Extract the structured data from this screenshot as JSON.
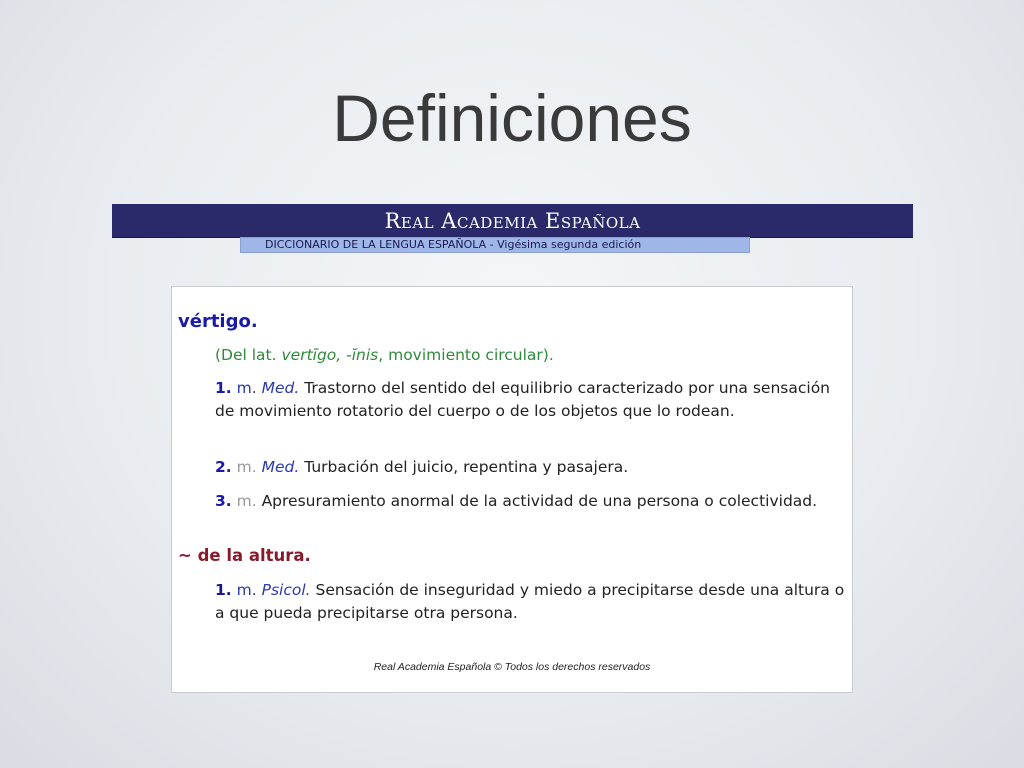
{
  "slide": {
    "title": "Definiciones"
  },
  "rae": {
    "name": "Real Academia Española",
    "subtitle": "DICCIONARIO DE LA LENGUA ESPAÑOLA - Vigésima segunda edición"
  },
  "entry": {
    "headword": "vértigo",
    "headword_dot": ".",
    "etymology": {
      "prefix": "(Del lat. ",
      "latin": "vertīgo, -ĭnis",
      "suffix": ", movimiento circular)."
    },
    "senses": [
      {
        "number": "1.",
        "grammar": "m.",
        "field": "Med.",
        "definition": " Trastorno del sentido del equilibrio caracterizado por una sensación de movimiento rotatorio del cuerpo o de los objetos que lo rodean."
      },
      {
        "number": "2.",
        "grammar": "m.",
        "field": "Med.",
        "definition": " Turbación del juicio, repentina y pasajera."
      },
      {
        "number": "3.",
        "grammar": "m.",
        "field": "",
        "definition": " Apresuramiento anormal de la actividad de una persona o colectividad."
      }
    ],
    "subentry": {
      "phrase": "~ de la altura.",
      "sense": {
        "number": "1.",
        "grammar": "m.",
        "field": "Psicol.",
        "definition": " Sensación de inseguridad y miedo a precipitarse desde una altura o a que pueda precipitarse otra persona."
      }
    }
  },
  "footer": {
    "copyright": "Real Academia Española © Todos los derechos reservados"
  }
}
